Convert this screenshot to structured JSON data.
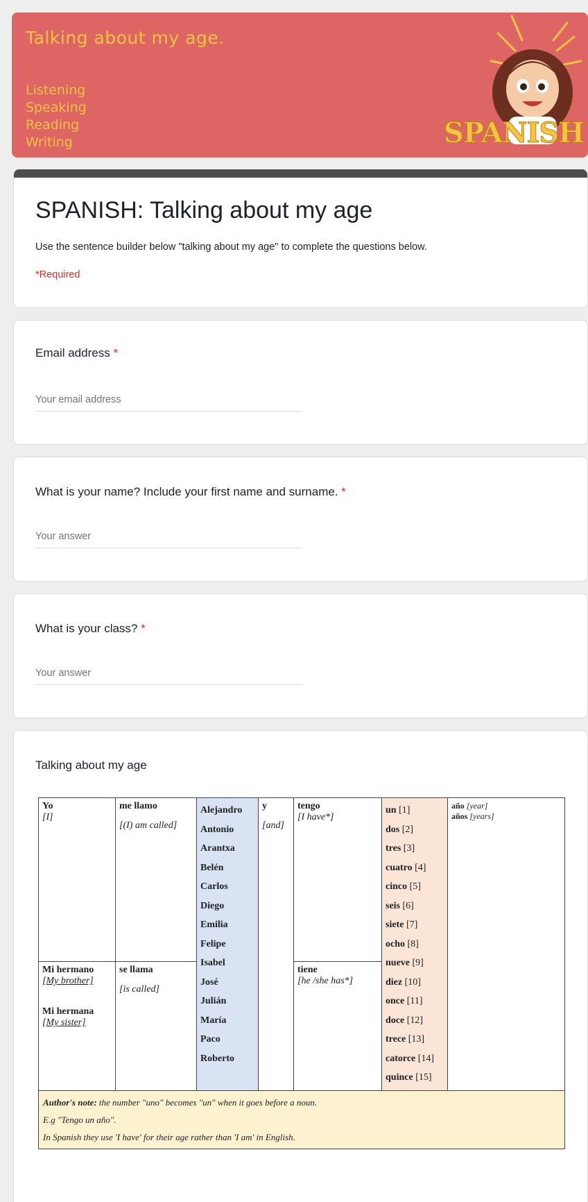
{
  "banner": {
    "title": "Talking about my age.",
    "skills": [
      "Listening",
      "Speaking",
      "Reading",
      "Writing"
    ],
    "logo_text": "SPANISH"
  },
  "form": {
    "title": "SPANISH: Talking about my age",
    "description": "Use the sentence builder below \"talking about my age\" to complete the questions below.",
    "required_note": "*Required"
  },
  "questions": {
    "email": {
      "label": "Email address",
      "star": "*",
      "placeholder": "Your email address"
    },
    "name": {
      "label": "What is your name? Include your first name and surname.",
      "star": "*",
      "placeholder": "Your answer"
    },
    "class": {
      "label": "What is your class?",
      "star": "*",
      "placeholder": "Your answer"
    }
  },
  "builder": {
    "heading": "Talking about my age",
    "col1": {
      "yo": "Yo",
      "yo_en": "[I]",
      "hermano": "Mi hermano",
      "hermano_en": "[My brother]",
      "hermana": "Mi hermana",
      "hermana_en": "[My sister]"
    },
    "col2": {
      "me_llamo": "me llamo",
      "me_llamo_en": "[(I) am called]",
      "se_llama": "se llama",
      "se_llama_en": "[is called]"
    },
    "names": [
      "Alejandro",
      "Antonio",
      "Arantxa",
      "Belén",
      "Carlos",
      "Diego",
      "Emilia",
      "Felipe",
      "Isabel",
      "José",
      "Julián",
      "María",
      "Paco",
      "Roberto"
    ],
    "col4": {
      "y": "y",
      "y_en": "[and]"
    },
    "col5": {
      "tengo": "tengo",
      "tengo_en": "[I have*]",
      "tiene": "tiene",
      "tiene_en": "[he /she has*]"
    },
    "numbers": [
      {
        "es": "un",
        "n": "[1]"
      },
      {
        "es": "dos",
        "n": "[2]"
      },
      {
        "es": "tres",
        "n": "[3]"
      },
      {
        "es": "cuatro",
        "n": "[4]"
      },
      {
        "es": "cinco",
        "n": "[5]"
      },
      {
        "es": "seis",
        "n": "[6]"
      },
      {
        "es": "siete",
        "n": "[7]"
      },
      {
        "es": "ocho",
        "n": "[8]"
      },
      {
        "es": "nueve",
        "n": "[9]"
      },
      {
        "es": "diez",
        "n": "[10]"
      },
      {
        "es": "once",
        "n": "[11]"
      },
      {
        "es": "doce",
        "n": "[12]"
      },
      {
        "es": "trece",
        "n": "[13]"
      },
      {
        "es": "catorce",
        "n": "[14]"
      },
      {
        "es": "quince",
        "n": "[15]"
      }
    ],
    "col7": {
      "ano": "año",
      "ano_en": "[year]",
      "anos": "años",
      "anos_en": "[years]"
    },
    "note": {
      "label": "Author's note:",
      "line1": "the number \"uno\" becomes \"un\" when it goes before a noun.",
      "line2": "E.g \"Tengo un año\".",
      "line3": "In Spanish they use 'I have' for their age rather than 'I am' in English."
    }
  },
  "colors": {
    "banner": "#dd6563",
    "banner_text": "#f6c343",
    "required": "#d93025",
    "title_bar": "#4d4d4d",
    "names_bg": "#dae3f3",
    "numbers_bg": "#fbe5d6",
    "note_bg": "#fdf2d0"
  }
}
